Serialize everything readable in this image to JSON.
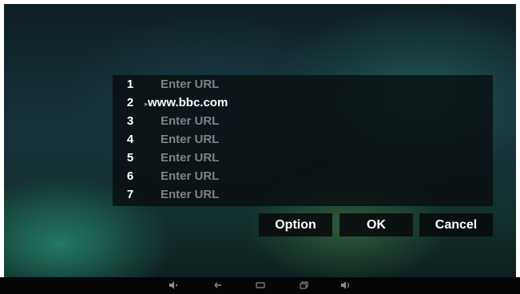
{
  "url_list": {
    "rows": [
      {
        "index": "1",
        "value": "Enter URL",
        "filled": false
      },
      {
        "index": "2",
        "value": "www.bbc.com",
        "filled": true
      },
      {
        "index": "3",
        "value": "Enter URL",
        "filled": false
      },
      {
        "index": "4",
        "value": "Enter URL",
        "filled": false
      },
      {
        "index": "5",
        "value": "Enter URL",
        "filled": false
      },
      {
        "index": "6",
        "value": "Enter URL",
        "filled": false
      },
      {
        "index": "7",
        "value": "Enter URL",
        "filled": false
      }
    ]
  },
  "buttons": {
    "option_label": "Option",
    "ok_label": "OK",
    "cancel_label": "Cancel"
  },
  "nav_bar": {
    "icons": [
      "volume-down-icon",
      "back-icon",
      "home-icon",
      "recent-apps-icon",
      "volume-up-icon"
    ]
  },
  "colors": {
    "panel": "#0a0e10",
    "placeholder_text": "#7c8386",
    "active_text": "#ffffff"
  }
}
